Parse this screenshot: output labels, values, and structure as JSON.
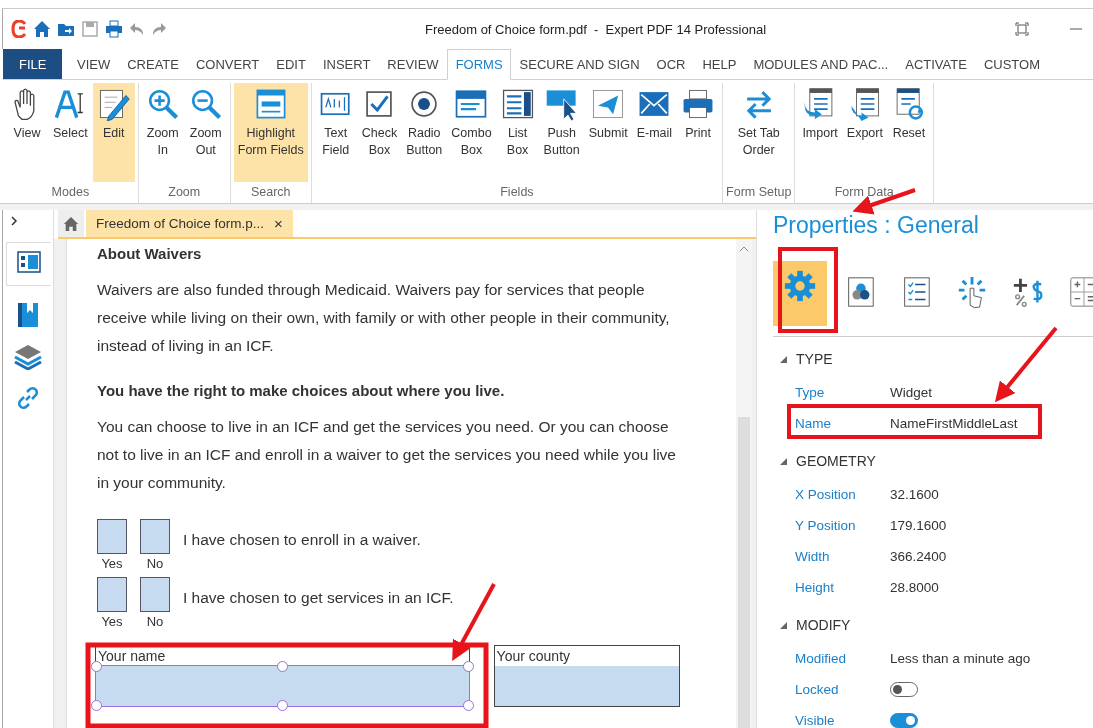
{
  "title_bar": {
    "title": "Freedom of Choice form.pdf  -  Expert PDF 14 Professional"
  },
  "menu_tabs": [
    {
      "label": "FILE",
      "kind": "file",
      "selected": false
    },
    {
      "label": "VIEW",
      "kind": "tab",
      "selected": false
    },
    {
      "label": "CREATE",
      "kind": "tab",
      "selected": false
    },
    {
      "label": "CONVERT",
      "kind": "tab",
      "selected": false
    },
    {
      "label": "EDIT",
      "kind": "tab",
      "selected": false
    },
    {
      "label": "INSERT",
      "kind": "tab",
      "selected": false
    },
    {
      "label": "REVIEW",
      "kind": "tab",
      "selected": false
    },
    {
      "label": "FORMS",
      "kind": "tab",
      "selected": true
    },
    {
      "label": "SECURE AND SIGN",
      "kind": "tab",
      "selected": false
    },
    {
      "label": "OCR",
      "kind": "tab",
      "selected": false
    },
    {
      "label": "HELP",
      "kind": "tab",
      "selected": false
    },
    {
      "label": "MODULES AND PAC...",
      "kind": "tab",
      "selected": false
    },
    {
      "label": "ACTIVATE",
      "kind": "tab",
      "selected": false
    },
    {
      "label": "CUSTOM",
      "kind": "tab",
      "selected": false
    }
  ],
  "ribbon_groups": [
    {
      "label": "Modes",
      "buttons": [
        {
          "label": "View",
          "selected": false
        },
        {
          "label": "Select",
          "selected": false
        },
        {
          "label": "Edit",
          "selected": true
        }
      ]
    },
    {
      "label": "Zoom",
      "buttons": [
        {
          "label": "Zoom\nIn",
          "selected": false
        },
        {
          "label": "Zoom\nOut",
          "selected": false
        }
      ]
    },
    {
      "label": "Search",
      "buttons": [
        {
          "label": "Highlight\nForm Fields",
          "selected": true
        }
      ]
    },
    {
      "label": "Fields",
      "buttons": [
        {
          "label": "Text\nField",
          "selected": false
        },
        {
          "label": "Check\nBox",
          "selected": false
        },
        {
          "label": "Radio\nButton",
          "selected": false
        },
        {
          "label": "Combo\nBox",
          "selected": false
        },
        {
          "label": "List\nBox",
          "selected": false
        },
        {
          "label": "Push\nButton",
          "selected": false
        },
        {
          "label": "Submit",
          "selected": false
        },
        {
          "label": "E-mail",
          "selected": false
        },
        {
          "label": "Print",
          "selected": false
        }
      ]
    },
    {
      "label": "Form Setup",
      "buttons": [
        {
          "label": "Set Tab\nOrder",
          "selected": false
        }
      ]
    },
    {
      "label": "Form Data",
      "buttons": [
        {
          "label": "Import",
          "selected": false
        },
        {
          "label": "Export",
          "selected": false
        },
        {
          "label": "Reset",
          "selected": false
        }
      ]
    }
  ],
  "document_tab": {
    "label": "Freedom of Choice form.p...",
    "close": "×"
  },
  "document": {
    "blocks": [
      {
        "kind": "heading",
        "text": "About Waivers"
      },
      {
        "kind": "paragraph",
        "text": "Waivers are also funded through Medicaid. Waivers pay for services that people receive while living on their own, with family or with other people in their community, instead of living in an ICF."
      },
      {
        "kind": "heading",
        "text": "You have the right to make choices about where you live."
      },
      {
        "kind": "paragraph",
        "text": "You can choose to live in an ICF and get the services you need. Or you can choose not to live in an ICF and enroll in a waiver to get the services you need while you live in your community."
      }
    ],
    "choices": [
      {
        "options": [
          "Yes",
          "No"
        ],
        "statement": "I have chosen to enroll in a waiver."
      },
      {
        "options": [
          "Yes",
          "No"
        ],
        "statement": "I have chosen to get services in an ICF."
      }
    ],
    "fields": [
      {
        "label": "Your name",
        "selected": true
      },
      {
        "label": "Your county",
        "selected": false
      }
    ]
  },
  "properties": {
    "title": "Properties : General",
    "tabs": [
      {
        "selected": true
      },
      {
        "selected": false
      },
      {
        "selected": false
      },
      {
        "selected": false
      },
      {
        "selected": false
      },
      {
        "selected": false
      }
    ],
    "sections": [
      {
        "title": "TYPE",
        "expanded": true,
        "rows": [
          {
            "kind": "text",
            "label": "Type",
            "value": "Widget"
          },
          {
            "kind": "text",
            "label": "Name",
            "value": "NameFirstMiddleLast"
          }
        ]
      },
      {
        "title": "GEOMETRY",
        "expanded": true,
        "rows": [
          {
            "kind": "text",
            "label": "X Position",
            "value": "32.1600"
          },
          {
            "kind": "text",
            "label": "Y Position",
            "value": "179.1600"
          },
          {
            "kind": "text",
            "label": "Width",
            "value": "366.2400"
          },
          {
            "kind": "text",
            "label": "Height",
            "value": "28.8000"
          }
        ]
      },
      {
        "title": "MODIFY",
        "expanded": true,
        "rows": [
          {
            "kind": "text",
            "label": "Modified",
            "value": "Less than a minute ago"
          },
          {
            "kind": "toggle",
            "label": "Locked",
            "on": false
          },
          {
            "kind": "toggle",
            "label": "Visible",
            "on": true
          }
        ]
      }
    ]
  }
}
